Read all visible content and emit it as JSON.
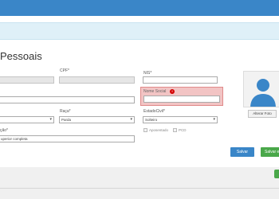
{
  "page": {
    "title": "Pessoais"
  },
  "form": {
    "cpf_label": "CPF*",
    "nis_label": "NIS*",
    "nome_social_label": "Nome Social",
    "error_glyph": "!",
    "raca_label": "Raça*",
    "raca_value": "Parda",
    "estado_civil_label": "EstadoCivil*",
    "estado_civil_value": "Solteiro",
    "escolaridade_label": "ção*",
    "escolaridade_value": "uperior completa",
    "aposentado_label": "Aposentado",
    "pcd_label": "PCD"
  },
  "photo": {
    "alter_button": "Alterar Foto"
  },
  "actions": {
    "save": "Salvar",
    "save_continue": "Salvar e"
  },
  "colors": {
    "topbar": "#3a86c8",
    "error_field": "#f2c4c4",
    "save": "#3a86c8",
    "save_continue": "#4aa84a"
  },
  "icons": {
    "error": "alert-circle-icon",
    "avatar": "user-silhouette-icon",
    "select_caret": "chevron-down-icon"
  }
}
